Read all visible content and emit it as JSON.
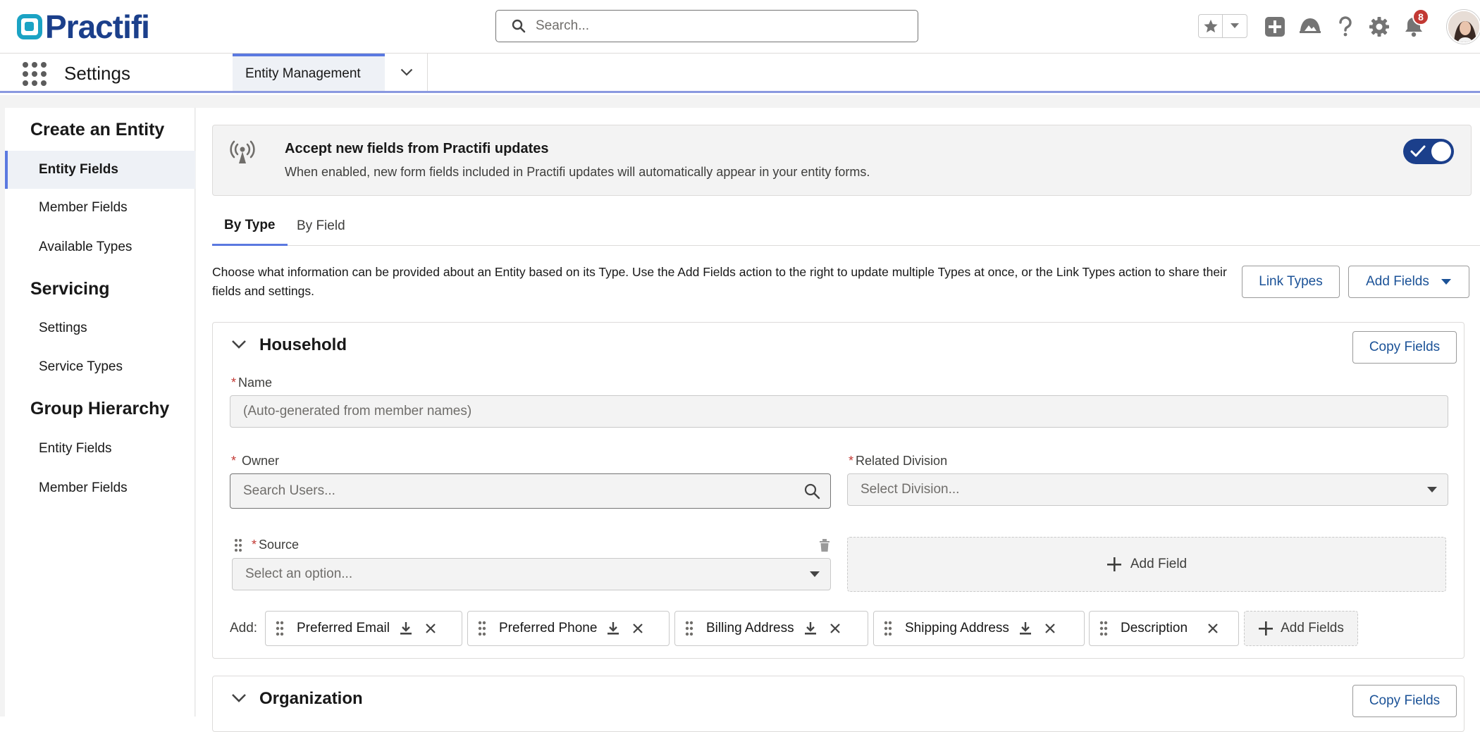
{
  "header": {
    "brand": "Practifi",
    "search_placeholder": "Search...",
    "notification_count": "8"
  },
  "nav": {
    "app_name": "Settings",
    "tab_label": "Entity Management"
  },
  "sidebar": {
    "sections": [
      {
        "heading": "Create an Entity",
        "items": [
          {
            "label": "Entity Fields",
            "active": true
          },
          {
            "label": "Member Fields"
          },
          {
            "label": "Available Types"
          }
        ]
      },
      {
        "heading": "Servicing",
        "items": [
          {
            "label": "Settings"
          },
          {
            "label": "Service Types"
          }
        ]
      },
      {
        "heading": "Group Hierarchy",
        "items": [
          {
            "label": "Entity Fields"
          },
          {
            "label": "Member Fields"
          }
        ]
      }
    ]
  },
  "banner": {
    "title": "Accept new fields from Practifi updates",
    "description": "When enabled, new form fields included in Practifi updates will automatically appear in your entity forms.",
    "toggle_on": true
  },
  "tabs": [
    {
      "label": "By Type",
      "active": true
    },
    {
      "label": "By Field"
    }
  ],
  "intro": {
    "text": "Choose what information can be provided about an Entity based on its Type. Use the Add Fields action to the right to update multiple Types at once, or the Link Types action to share their fields and settings.",
    "link_types_label": "Link Types",
    "add_fields_label": "Add Fields"
  },
  "household": {
    "title": "Household",
    "copy_fields_label": "Copy Fields",
    "name_label": "Name",
    "name_placeholder": "(Auto-generated from member names)",
    "owner_label": "Owner",
    "owner_placeholder": "Search Users...",
    "division_label": "Related Division",
    "division_placeholder": "Select Division...",
    "source_label": "Source",
    "source_placeholder": "Select an option...",
    "add_field_label": "Add Field",
    "add_prefix": "Add:",
    "chips": [
      "Preferred Email",
      "Preferred Phone",
      "Billing Address",
      "Shipping Address",
      "Description"
    ],
    "add_fields_chip": "Add Fields"
  },
  "organization": {
    "title": "Organization",
    "copy_fields_label": "Copy Fields"
  },
  "colors": {
    "brand": "#1b3f8b",
    "accent": "#5b79e0",
    "link": "#1b5297",
    "required": "#c23934"
  },
  "icons": [
    "practifi-logo-icon",
    "search-icon",
    "star-icon",
    "chevron-down-icon",
    "add-icon",
    "trailhead-icon",
    "help-icon",
    "gear-icon",
    "bell-icon",
    "app-launcher-icon",
    "broadcast-icon",
    "check-icon",
    "trash-icon",
    "grip-icon",
    "download-icon",
    "close-icon",
    "plus-icon"
  ]
}
